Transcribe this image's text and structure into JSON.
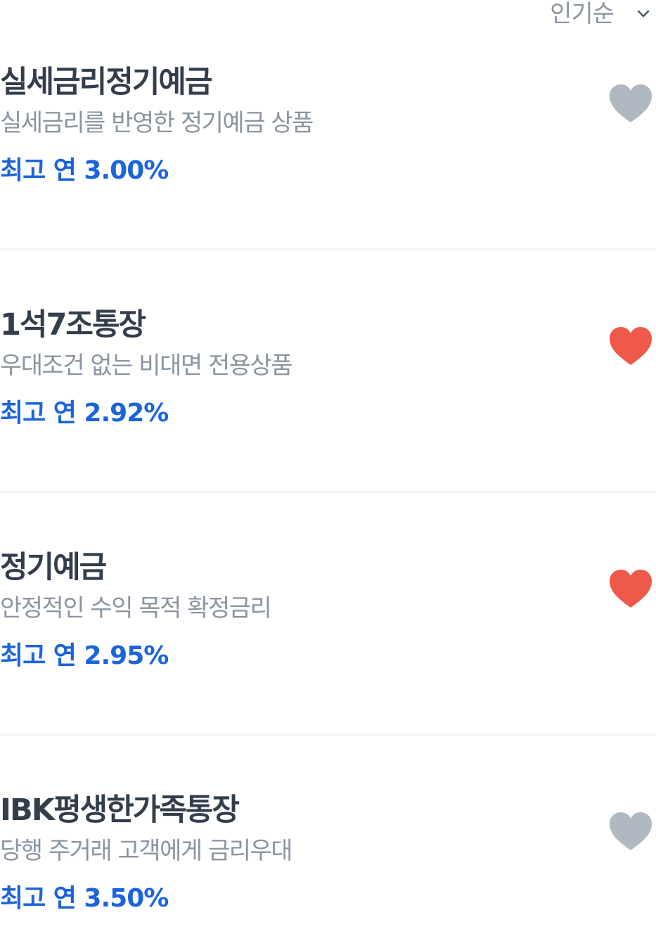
{
  "sort": {
    "label": "인기순"
  },
  "colors": {
    "title": "#333d4b",
    "desc": "#8b95a1",
    "rate": "#1b64da",
    "heart_on": "#ee5a4a",
    "heart_off": "#b0b8c1"
  },
  "products": [
    {
      "title": "실세금리정기예금",
      "desc": "실세금리를 반영한 정기예금 상품",
      "rate": "최고 연 3.00%",
      "favorited": false
    },
    {
      "title": "1석7조통장",
      "desc": "우대조건 없는 비대면 전용상품",
      "rate": "최고 연 2.92%",
      "favorited": true
    },
    {
      "title": "정기예금",
      "desc": "안정적인 수익 목적 확정금리",
      "rate": "최고 연 2.95%",
      "favorited": true
    },
    {
      "title": "IBK평생한가족통장",
      "desc": "당행 주거래 고객에게 금리우대",
      "rate": "최고 연 3.50%",
      "favorited": false
    }
  ]
}
